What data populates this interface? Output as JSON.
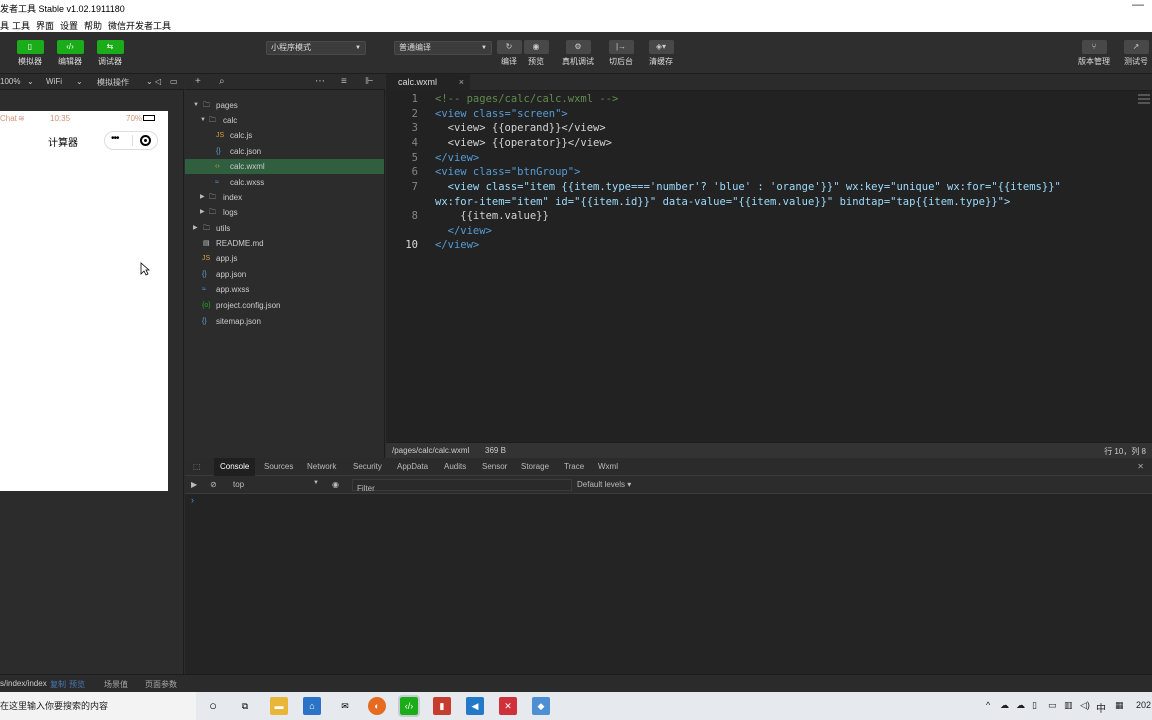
{
  "window": {
    "title": "发者工具 Stable v1.02.1911180",
    "minimize": "—"
  },
  "menu": [
    "具",
    "工具",
    "界面",
    "设置",
    "帮助",
    "微信开发者工具"
  ],
  "toolbar": {
    "simulator": "模拟器",
    "editor": "编辑器",
    "debugger": "调试器",
    "mode": "小程序模式",
    "compile_mode": "普通编译",
    "compile": "编译",
    "preview": "预览",
    "remote_debug": "真机调试",
    "background": "切后台",
    "clear_cache": "清缓存",
    "version": "版本管理",
    "test": "测试号"
  },
  "simbar": {
    "zoom": "100%",
    "network": "WiFi",
    "ops": "模拟操作"
  },
  "phone": {
    "carrier": "Chat",
    "time": "10:35",
    "battery": "70%",
    "nav_title": "计算器"
  },
  "files": [
    {
      "name": "pages",
      "type": "folder",
      "open": true,
      "depth": 0
    },
    {
      "name": "calc",
      "type": "folder",
      "open": true,
      "depth": 1
    },
    {
      "name": "calc.js",
      "type": "js",
      "depth": 2
    },
    {
      "name": "calc.json",
      "type": "json",
      "depth": 2
    },
    {
      "name": "calc.wxml",
      "type": "wxml",
      "depth": 2,
      "active": true
    },
    {
      "name": "calc.wxss",
      "type": "wxss",
      "depth": 2
    },
    {
      "name": "index",
      "type": "folder",
      "open": false,
      "depth": 1
    },
    {
      "name": "logs",
      "type": "folder",
      "open": false,
      "depth": 1
    },
    {
      "name": "utils",
      "type": "folder",
      "open": false,
      "depth": 0
    },
    {
      "name": "README.md",
      "type": "md",
      "depth": 0
    },
    {
      "name": "app.js",
      "type": "js",
      "depth": 0
    },
    {
      "name": "app.json",
      "type": "json",
      "depth": 0
    },
    {
      "name": "app.wxss",
      "type": "wxss",
      "depth": 0
    },
    {
      "name": "project.config.json",
      "type": "config",
      "depth": 0
    },
    {
      "name": "sitemap.json",
      "type": "json",
      "depth": 0
    }
  ],
  "editor": {
    "tab": "calc.wxml",
    "lines": [
      {
        "n": "1",
        "c": "<!-- pages/calc/calc.wxml -->"
      },
      {
        "n": "2",
        "c": "<view class=\"screen\">"
      },
      {
        "n": "3",
        "c": "  <view> {{operand}}</view>"
      },
      {
        "n": "4",
        "c": "  <view> {{operator}}</view>"
      },
      {
        "n": "5",
        "c": "</view>"
      },
      {
        "n": "6",
        "c": "<view class=\"btnGroup\">"
      },
      {
        "n": "7",
        "c": "  <view class=\"item {{item.type==='number'? 'blue' : 'orange'}}\" wx:key=\"unique\" wx:for=\"{{items}}\""
      },
      {
        "n": "",
        "c": "wx:for-item=\"item\" id=\"{{item.id}}\" data-value=\"{{item.value}}\" bindtap=\"tap{{item.type}}\">"
      },
      {
        "n": "8",
        "c": "    {{item.value}}"
      },
      {
        "n": "9",
        "c": "  </view>"
      },
      {
        "n": "10",
        "c": "</view>"
      }
    ]
  },
  "status": {
    "path": "/pages/calc/calc.wxml",
    "size": "369 B",
    "position": "行 10，列 8"
  },
  "devtools": {
    "tabs": [
      "Console",
      "Sources",
      "Network",
      "Security",
      "AppData",
      "Audits",
      "Sensor",
      "Storage",
      "Trace",
      "Wxml"
    ],
    "context": "top",
    "filter_placeholder": "Filter",
    "levels": "Default levels ▾",
    "prompt": "›"
  },
  "bottom": {
    "path": "s/index/index",
    "copy": "复制",
    "preview": "预览",
    "scene": "场景值",
    "params": "页面参数"
  },
  "taskbar": {
    "search": "在这里输入你要搜索的内容",
    "ime": "中",
    "date": "202"
  }
}
